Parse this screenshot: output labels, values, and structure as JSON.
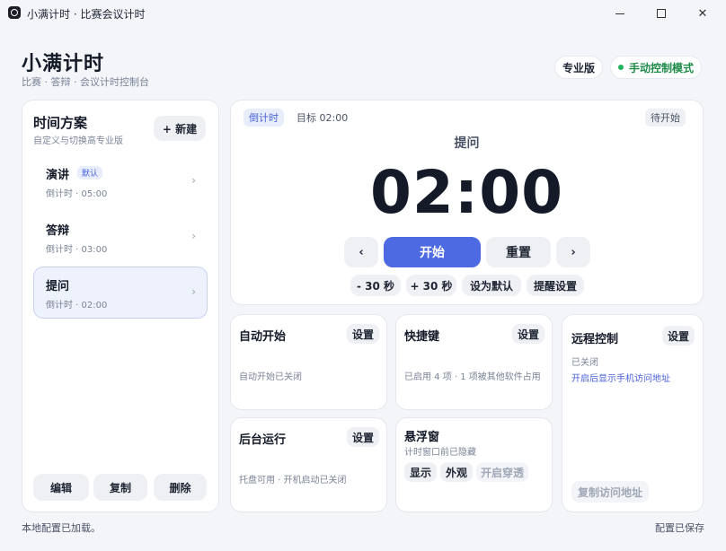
{
  "window": {
    "title": "小满计时 · 比赛会议计时"
  },
  "header": {
    "title": "小满计时",
    "subtitle": "比赛 · 答辩 · 会议计时控制台",
    "pro_badge": "专业版",
    "mode_badge": "手动控制模式",
    "mode_color": "#22b35e"
  },
  "plans": {
    "title": "时间方案",
    "subtitle": "自定义与切换高专业版",
    "new_label": "+ 新建",
    "items": [
      {
        "name": "演讲",
        "badge": "默认",
        "meta": "倒计时  ·  05:00",
        "active": false
      },
      {
        "name": "答辩",
        "meta": "倒计时  ·  03:00",
        "active": false
      },
      {
        "name": "提问",
        "meta": "倒计时  ·  02:00",
        "active": true
      }
    ],
    "edit_label": "编辑",
    "copy_label": "复制",
    "delete_label": "删除"
  },
  "timer": {
    "mode_tag": "倒计时",
    "target": "目标  02:00",
    "state": "待开始",
    "current_name": "提问",
    "time": "02:00",
    "prev": "‹",
    "start": "开始",
    "reset": "重置",
    "next": "›",
    "minus30": "- 30 秒",
    "plus30": "+ 30 秒",
    "set_default": "设为默认",
    "remind": "提醒设置",
    "accent": "#4d6ae3"
  },
  "features": {
    "auto": {
      "title": "自动开始",
      "setting": "设置",
      "desc": "自动开始已关闭"
    },
    "hotkey": {
      "title": "快捷键",
      "setting": "设置",
      "desc": "已启用 4 项 · 1 项被其他软件占用"
    },
    "remote": {
      "title": "远程控制",
      "setting": "设置",
      "status": "已关闭",
      "link": "开启后显示手机访问地址",
      "copy": "复制访问地址"
    },
    "bg": {
      "title": "后台运行",
      "setting": "设置",
      "desc": "托盘可用 · 开机启动已关闭"
    },
    "float": {
      "title": "悬浮窗",
      "desc": "计时窗口前已隐藏",
      "show": "显示",
      "appearance": "外观",
      "passthrough": "开启穿透"
    }
  },
  "status": {
    "left": "本地配置已加载。",
    "right": "配置已保存"
  }
}
